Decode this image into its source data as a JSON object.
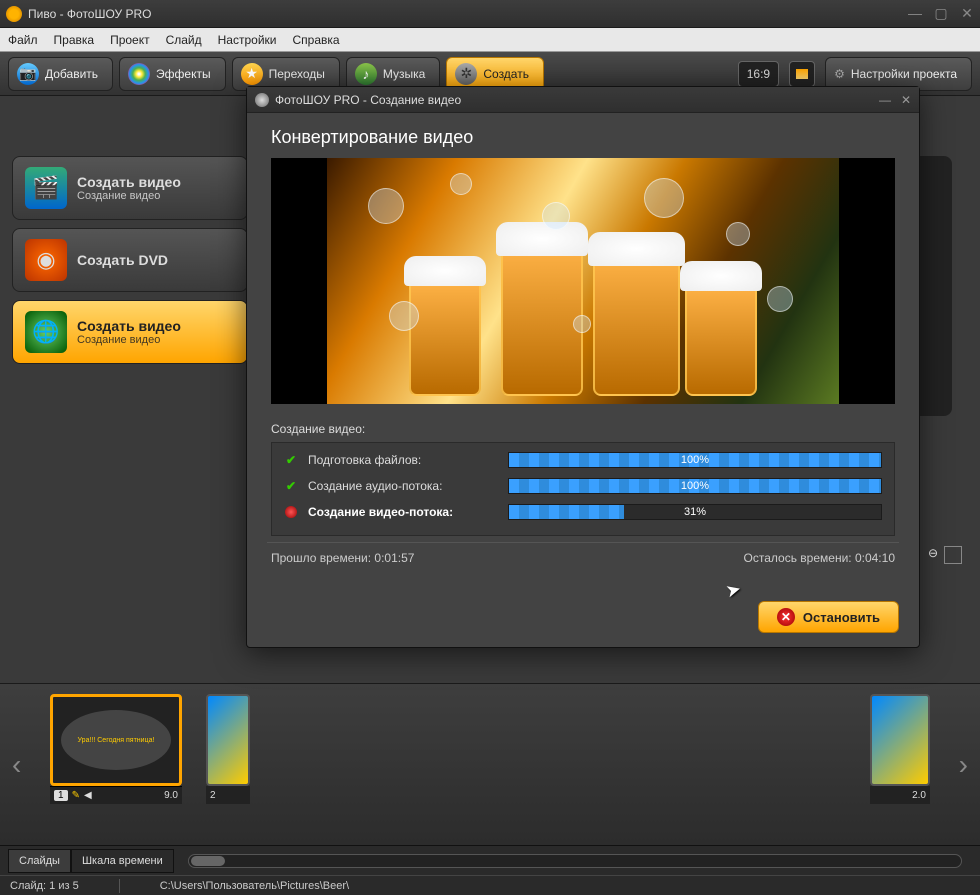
{
  "window": {
    "title": "Пиво - ФотоШОУ PRO"
  },
  "menu": {
    "file": "Файл",
    "edit": "Правка",
    "project": "Проект",
    "slide": "Слайд",
    "settings": "Настройки",
    "help": "Справка"
  },
  "toolbar": {
    "add": "Добавить",
    "effects": "Эффекты",
    "transitions": "Переходы",
    "music": "Музыка",
    "create": "Создать",
    "ratio": "16:9",
    "project_settings": "Настройки проекта"
  },
  "cards": {
    "video": {
      "title": "Создать видео",
      "sub": "Создание видео"
    },
    "dvd": {
      "title": "Создать DVD",
      "sub": ""
    },
    "web": {
      "title": "Создать видео",
      "sub": "Создание видео"
    }
  },
  "timeline": {
    "slide1": {
      "index": "1",
      "duration": "9.0",
      "text": "Ура!!! Сегодня пятница!"
    },
    "trans1": {
      "index": "2"
    },
    "trans2": {
      "duration": "2.0"
    }
  },
  "bottom": {
    "tab_slides": "Слайды",
    "tab_timeline": "Шкала времени"
  },
  "status": {
    "slide": "Слайд: 1 из 5",
    "path": "C:\\Users\\Пользователь\\Pictures\\Beer\\"
  },
  "dialog": {
    "title": "ФотоШОУ PRO - Создание видео",
    "heading": "Конвертирование видео",
    "section": "Создание видео:",
    "step1": "Подготовка файлов:",
    "step2": "Создание аудио-потока:",
    "step3": "Создание видео-потока:",
    "pct1": "100%",
    "pct2": "100%",
    "pct3": "31%",
    "pct3_val": 31,
    "elapsed_label": "Прошло времени:",
    "elapsed": "0:01:57",
    "remaining_label": "Осталось времени:",
    "remaining": "0:04:10",
    "stop": "Остановить"
  }
}
